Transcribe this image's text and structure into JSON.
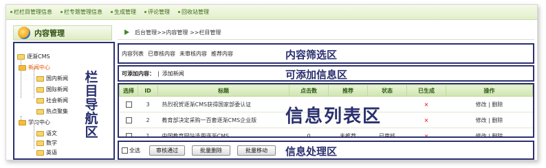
{
  "topnav": {
    "items": [
      {
        "label": "栏栏目管理信息"
      },
      {
        "label": "栏专题管理信息"
      },
      {
        "label": "生成管理"
      },
      {
        "label": "评论管理"
      },
      {
        "label": "回收站管理"
      }
    ]
  },
  "sidebar": {
    "title": "内容管理",
    "zone_label": "栏目导航区",
    "tree": [
      {
        "label": "逐渐CMS"
      },
      {
        "label": "新闻中心"
      },
      {
        "label": "国内新闻"
      },
      {
        "label": "国际新闻"
      },
      {
        "label": "社会新闻"
      },
      {
        "label": "热点聚集"
      },
      {
        "label": "学习中心"
      },
      {
        "label": "语文"
      },
      {
        "label": "数学"
      },
      {
        "label": "英语"
      }
    ]
  },
  "breadcrumb": {
    "text": "后台管理>>内容管理 >>栏目管理"
  },
  "filter": {
    "tabs": [
      "内容列表",
      "已审核内容",
      "未审核内容",
      "推荐内容"
    ],
    "zone_label": "内容筛选区"
  },
  "add": {
    "prompt": "可添加内容：",
    "separator": "|",
    "link": "添加新闻",
    "zone_label": "可添加信息区"
  },
  "list": {
    "zone_label": "信息列表区",
    "headers": [
      "选择",
      "ID",
      "标题",
      "点击数",
      "推荐",
      "状态",
      "已生成",
      "操作"
    ],
    "rows": [
      {
        "id": "3",
        "title": "热烈祝贺逐渐CMS获得国家部委认证",
        "clicks": "",
        "recommend": "",
        "status": "",
        "generated": "×",
        "edit": "修改",
        "sep": "|",
        "del": "删除"
      },
      {
        "id": "2",
        "title": "教育部决定采购一百套逐渐CMS企业版",
        "clicks": "",
        "recommend": "",
        "status": "",
        "generated": "×",
        "edit": "修改",
        "sep": "|",
        "del": "删除"
      },
      {
        "id": "1",
        "title": "中国教育网站选用逐渐CMS",
        "clicks": "0",
        "recommend": "未推荐",
        "status": "已审核",
        "generated": "×",
        "edit": "修改",
        "sep": "|",
        "del": "删除"
      }
    ]
  },
  "ops": {
    "select_all": "全选",
    "buttons": [
      "审核通过",
      "批量删除",
      "批量移动"
    ],
    "zone_label": "信息处理区"
  },
  "colors": {
    "accent": "#2a2f6e",
    "nav_green": "#3b6b12",
    "delete_red": "#e33333"
  }
}
